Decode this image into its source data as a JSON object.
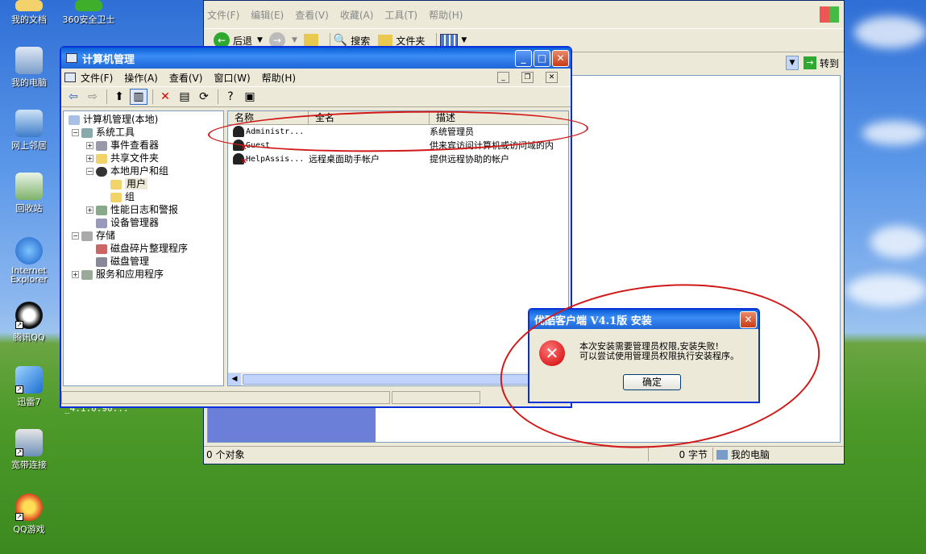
{
  "desktop": {
    "icons": [
      {
        "label": "我的文档",
        "icon": "my-documents-icon"
      },
      {
        "label": "360安全卫士",
        "icon": "360-security-icon"
      },
      {
        "label": "我的电脑",
        "icon": "my-computer-icon"
      },
      {
        "label": "网上邻居",
        "icon": "network-places-icon"
      },
      {
        "label": "回收站",
        "icon": "recycle-bin-icon"
      },
      {
        "label": "Internet\nExplorer",
        "icon": "ie-icon"
      },
      {
        "label": "腾讯QQ",
        "icon": "qq-icon"
      },
      {
        "label": "迅雷7",
        "icon": "xunlei-icon"
      },
      {
        "label": "宽带连接",
        "icon": "broadband-icon"
      },
      {
        "label": "QQ游戏",
        "icon": "qq-game-icon"
      }
    ],
    "partial_text": "_4.1.0.90..."
  },
  "explorer": {
    "menu": [
      "文件(F)",
      "编辑(E)",
      "查看(V)",
      "收藏(A)",
      "工具(T)",
      "帮助(H)"
    ],
    "back_label": "后退",
    "search_label": "搜索",
    "folders_label": "文件夹",
    "go_label": "转到",
    "status_left": "0 个对象",
    "status_bytes": "0 字节",
    "status_location": "我的电脑"
  },
  "mgmt": {
    "title": "计算机管理",
    "menu": [
      "文件(F)",
      "操作(A)",
      "查看(V)",
      "窗口(W)",
      "帮助(H)"
    ],
    "tree": {
      "root": "计算机管理(本地)",
      "system_tools": "系统工具",
      "event_viewer": "事件查看器",
      "shared_folders": "共享文件夹",
      "local_users": "本地用户和组",
      "users": "用户",
      "groups": "组",
      "perf_logs": "性能日志和警报",
      "device_mgr": "设备管理器",
      "storage": "存储",
      "defrag": "磁盘碎片整理程序",
      "disk_mgmt": "磁盘管理",
      "services": "服务和应用程序"
    },
    "columns": [
      "名称",
      "全名",
      "描述"
    ],
    "rows": [
      {
        "name": "Administr...",
        "full": "",
        "desc": "系统管理员",
        "disabled": false
      },
      {
        "name": "Guest",
        "full": "",
        "desc": "供来宾访问计算机或访问域的内",
        "disabled": true
      },
      {
        "name": "HelpAssis...",
        "full": "远程桌面助手帐户",
        "desc": "提供远程协助的帐户",
        "disabled": true
      }
    ]
  },
  "dialog": {
    "title": "优酷客户端 V4.1版 安装",
    "line1": "本次安装需要管理员权限,安装失败!",
    "line2": "可以尝试使用管理员权限执行安装程序。",
    "ok": "确定"
  },
  "colors": {
    "annotation": "#d01818",
    "titlebar": "#0a5fd8"
  }
}
